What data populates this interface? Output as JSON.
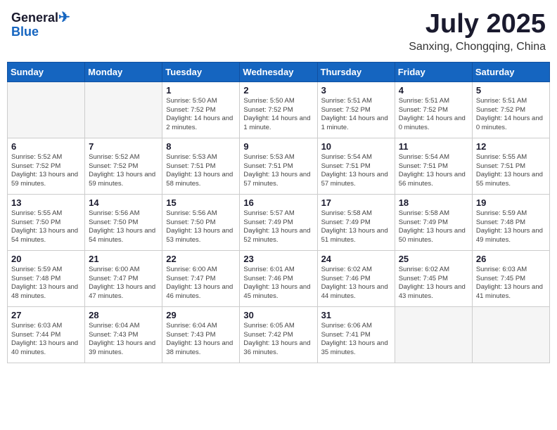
{
  "header": {
    "logo": {
      "general": "General",
      "blue": "Blue"
    },
    "month": "July 2025",
    "location": "Sanxing, Chongqing, China"
  },
  "days_of_week": [
    "Sunday",
    "Monday",
    "Tuesday",
    "Wednesday",
    "Thursday",
    "Friday",
    "Saturday"
  ],
  "weeks": [
    [
      {
        "day": null,
        "sunrise": null,
        "sunset": null,
        "daylight": null
      },
      {
        "day": null,
        "sunrise": null,
        "sunset": null,
        "daylight": null
      },
      {
        "day": "1",
        "sunrise": "Sunrise: 5:50 AM",
        "sunset": "Sunset: 7:52 PM",
        "daylight": "Daylight: 14 hours and 2 minutes."
      },
      {
        "day": "2",
        "sunrise": "Sunrise: 5:50 AM",
        "sunset": "Sunset: 7:52 PM",
        "daylight": "Daylight: 14 hours and 1 minute."
      },
      {
        "day": "3",
        "sunrise": "Sunrise: 5:51 AM",
        "sunset": "Sunset: 7:52 PM",
        "daylight": "Daylight: 14 hours and 1 minute."
      },
      {
        "day": "4",
        "sunrise": "Sunrise: 5:51 AM",
        "sunset": "Sunset: 7:52 PM",
        "daylight": "Daylight: 14 hours and 0 minutes."
      },
      {
        "day": "5",
        "sunrise": "Sunrise: 5:51 AM",
        "sunset": "Sunset: 7:52 PM",
        "daylight": "Daylight: 14 hours and 0 minutes."
      }
    ],
    [
      {
        "day": "6",
        "sunrise": "Sunrise: 5:52 AM",
        "sunset": "Sunset: 7:52 PM",
        "daylight": "Daylight: 13 hours and 59 minutes."
      },
      {
        "day": "7",
        "sunrise": "Sunrise: 5:52 AM",
        "sunset": "Sunset: 7:52 PM",
        "daylight": "Daylight: 13 hours and 59 minutes."
      },
      {
        "day": "8",
        "sunrise": "Sunrise: 5:53 AM",
        "sunset": "Sunset: 7:51 PM",
        "daylight": "Daylight: 13 hours and 58 minutes."
      },
      {
        "day": "9",
        "sunrise": "Sunrise: 5:53 AM",
        "sunset": "Sunset: 7:51 PM",
        "daylight": "Daylight: 13 hours and 57 minutes."
      },
      {
        "day": "10",
        "sunrise": "Sunrise: 5:54 AM",
        "sunset": "Sunset: 7:51 PM",
        "daylight": "Daylight: 13 hours and 57 minutes."
      },
      {
        "day": "11",
        "sunrise": "Sunrise: 5:54 AM",
        "sunset": "Sunset: 7:51 PM",
        "daylight": "Daylight: 13 hours and 56 minutes."
      },
      {
        "day": "12",
        "sunrise": "Sunrise: 5:55 AM",
        "sunset": "Sunset: 7:51 PM",
        "daylight": "Daylight: 13 hours and 55 minutes."
      }
    ],
    [
      {
        "day": "13",
        "sunrise": "Sunrise: 5:55 AM",
        "sunset": "Sunset: 7:50 PM",
        "daylight": "Daylight: 13 hours and 54 minutes."
      },
      {
        "day": "14",
        "sunrise": "Sunrise: 5:56 AM",
        "sunset": "Sunset: 7:50 PM",
        "daylight": "Daylight: 13 hours and 54 minutes."
      },
      {
        "day": "15",
        "sunrise": "Sunrise: 5:56 AM",
        "sunset": "Sunset: 7:50 PM",
        "daylight": "Daylight: 13 hours and 53 minutes."
      },
      {
        "day": "16",
        "sunrise": "Sunrise: 5:57 AM",
        "sunset": "Sunset: 7:49 PM",
        "daylight": "Daylight: 13 hours and 52 minutes."
      },
      {
        "day": "17",
        "sunrise": "Sunrise: 5:58 AM",
        "sunset": "Sunset: 7:49 PM",
        "daylight": "Daylight: 13 hours and 51 minutes."
      },
      {
        "day": "18",
        "sunrise": "Sunrise: 5:58 AM",
        "sunset": "Sunset: 7:49 PM",
        "daylight": "Daylight: 13 hours and 50 minutes."
      },
      {
        "day": "19",
        "sunrise": "Sunrise: 5:59 AM",
        "sunset": "Sunset: 7:48 PM",
        "daylight": "Daylight: 13 hours and 49 minutes."
      }
    ],
    [
      {
        "day": "20",
        "sunrise": "Sunrise: 5:59 AM",
        "sunset": "Sunset: 7:48 PM",
        "daylight": "Daylight: 13 hours and 48 minutes."
      },
      {
        "day": "21",
        "sunrise": "Sunrise: 6:00 AM",
        "sunset": "Sunset: 7:47 PM",
        "daylight": "Daylight: 13 hours and 47 minutes."
      },
      {
        "day": "22",
        "sunrise": "Sunrise: 6:00 AM",
        "sunset": "Sunset: 7:47 PM",
        "daylight": "Daylight: 13 hours and 46 minutes."
      },
      {
        "day": "23",
        "sunrise": "Sunrise: 6:01 AM",
        "sunset": "Sunset: 7:46 PM",
        "daylight": "Daylight: 13 hours and 45 minutes."
      },
      {
        "day": "24",
        "sunrise": "Sunrise: 6:02 AM",
        "sunset": "Sunset: 7:46 PM",
        "daylight": "Daylight: 13 hours and 44 minutes."
      },
      {
        "day": "25",
        "sunrise": "Sunrise: 6:02 AM",
        "sunset": "Sunset: 7:45 PM",
        "daylight": "Daylight: 13 hours and 43 minutes."
      },
      {
        "day": "26",
        "sunrise": "Sunrise: 6:03 AM",
        "sunset": "Sunset: 7:45 PM",
        "daylight": "Daylight: 13 hours and 41 minutes."
      }
    ],
    [
      {
        "day": "27",
        "sunrise": "Sunrise: 6:03 AM",
        "sunset": "Sunset: 7:44 PM",
        "daylight": "Daylight: 13 hours and 40 minutes."
      },
      {
        "day": "28",
        "sunrise": "Sunrise: 6:04 AM",
        "sunset": "Sunset: 7:43 PM",
        "daylight": "Daylight: 13 hours and 39 minutes."
      },
      {
        "day": "29",
        "sunrise": "Sunrise: 6:04 AM",
        "sunset": "Sunset: 7:43 PM",
        "daylight": "Daylight: 13 hours and 38 minutes."
      },
      {
        "day": "30",
        "sunrise": "Sunrise: 6:05 AM",
        "sunset": "Sunset: 7:42 PM",
        "daylight": "Daylight: 13 hours and 36 minutes."
      },
      {
        "day": "31",
        "sunrise": "Sunrise: 6:06 AM",
        "sunset": "Sunset: 7:41 PM",
        "daylight": "Daylight: 13 hours and 35 minutes."
      },
      {
        "day": null,
        "sunrise": null,
        "sunset": null,
        "daylight": null
      },
      {
        "day": null,
        "sunrise": null,
        "sunset": null,
        "daylight": null
      }
    ]
  ]
}
